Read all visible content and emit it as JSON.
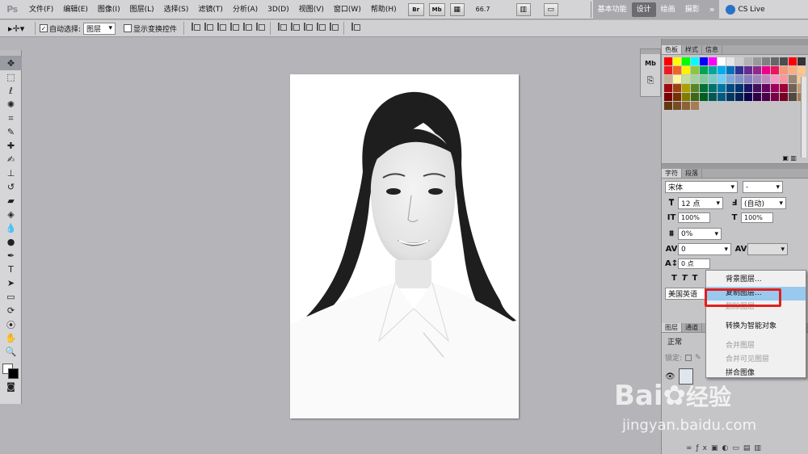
{
  "app": {
    "logo": "Ps"
  },
  "menu": [
    "文件(F)",
    "编辑(E)",
    "图像(I)",
    "图层(L)",
    "选择(S)",
    "滤镜(T)",
    "分析(A)",
    "3D(D)",
    "视图(V)",
    "窗口(W)",
    "帮助(H)"
  ],
  "menubar_buttons": {
    "br": "Br",
    "mb": "Mb",
    "zoom": "66.7"
  },
  "workspaces": {
    "basic": "基本功能",
    "design": "设计",
    "paint": "绘画",
    "photo": "摄影",
    "more": "»",
    "cslive": "CS Live"
  },
  "options": {
    "auto_select_label": "自动选择:",
    "auto_select_value": "图层",
    "show_transform": "显示变换控件"
  },
  "panels": {
    "color_tabs": [
      "色板",
      "样式",
      "信息"
    ],
    "char_tabs": [
      "字符",
      "段落"
    ],
    "font_family": "宋体",
    "font_style": "-",
    "font_size": "12 点",
    "leading": "(自动)",
    "vscale": "100%",
    "hscale": "100%",
    "tracking_pct": "0%",
    "kerning": "0",
    "baseline": "0 点",
    "language": "美国英语",
    "layer_tabs": [
      "图层",
      "通道"
    ],
    "blend_mode": "正常",
    "lock_label": "锁定:"
  },
  "swatch_colors": [
    "#ff0000",
    "#ffff00",
    "#00ff00",
    "#00ffff",
    "#0000ff",
    "#ff00ff",
    "#ffffff",
    "#e6e6e6",
    "#cccccc",
    "#b3b3b3",
    "#999999",
    "#808080",
    "#666666",
    "#4d4d4d",
    "#ff0000",
    "#333333",
    "#ed1c24",
    "#f26522",
    "#fff200",
    "#8dc63f",
    "#00a651",
    "#00a99d",
    "#00aeef",
    "#0072bc",
    "#2e3192",
    "#662d91",
    "#92278f",
    "#ec008c",
    "#ed145b",
    "#f7977a",
    "#fbad82",
    "#fdc68c",
    "#c7b299",
    "#fff799",
    "#c4df9b",
    "#a3d39c",
    "#82ca9c",
    "#7accc8",
    "#6dcff6",
    "#7da7d9",
    "#8393ca",
    "#8781bd",
    "#a186be",
    "#bd8cbf",
    "#f49ac2",
    "#f6989d",
    "#998675",
    "#fdc689",
    "#9e0b0f",
    "#a0410d",
    "#aba000",
    "#598527",
    "#007236",
    "#00746b",
    "#0076a3",
    "#004a80",
    "#003471",
    "#1b1464",
    "#440e62",
    "#630460",
    "#9e005d",
    "#9e0039",
    "#736357",
    "#c69c6d",
    "#790000",
    "#7b2e00",
    "#827b00",
    "#406618",
    "#005e20",
    "#005952",
    "#005b7f",
    "#003663",
    "#002157",
    "#0d004c",
    "#32004b",
    "#4b0049",
    "#7b0046",
    "#7a0026",
    "#534741",
    "#a67c52",
    "#603913",
    "#754c24",
    "#8c6239",
    "#a67c52"
  ],
  "context_menu": [
    {
      "label": "背景图层...",
      "disabled": false
    },
    {
      "label": "复制图层...",
      "disabled": false,
      "highlight": true
    },
    {
      "label": "删除图层",
      "disabled": true
    },
    {
      "label": "",
      "separator": true
    },
    {
      "label": "转换为智能对象",
      "disabled": false
    },
    {
      "label": "",
      "separator": true
    },
    {
      "label": "合并图层",
      "disabled": true
    },
    {
      "label": "合并可见图层",
      "disabled": true
    },
    {
      "label": "拼合图像",
      "disabled": false
    }
  ],
  "watermark": {
    "brand": "Bai",
    "suffix": "经验",
    "url": "jingyan.baidu.com"
  }
}
